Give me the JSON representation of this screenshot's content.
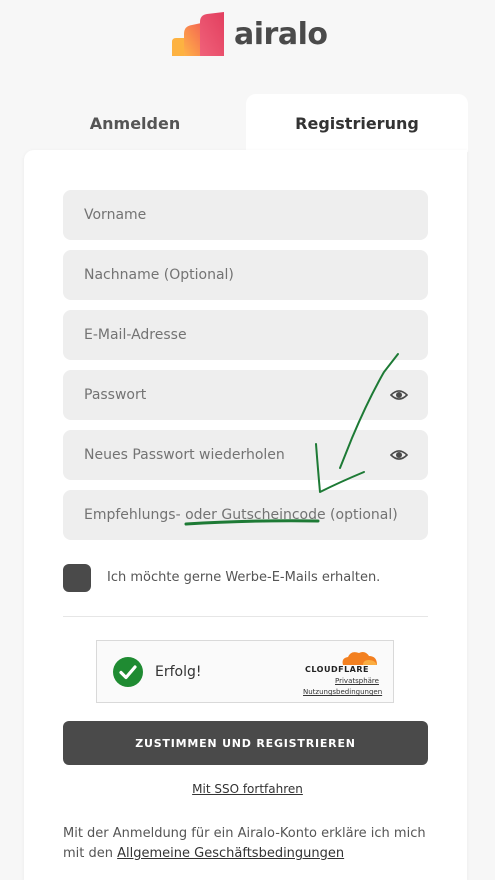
{
  "brand": {
    "name": "airalo"
  },
  "tabs": {
    "login": "Anmelden",
    "register": "Registrierung"
  },
  "form": {
    "first_name_placeholder": "Vorname",
    "last_name_placeholder": "Nachname (Optional)",
    "email_placeholder": "E-Mail-Adresse",
    "password_placeholder": "Passwort",
    "password_repeat_placeholder": "Neues Passwort wiederholen",
    "referral_placeholder": "Empfehlungs- oder Gutscheincode (optional)",
    "newsletter_label": "Ich möchte gerne Werbe-E-Mails erhalten."
  },
  "captcha": {
    "status": "Erfolg!",
    "brand": "CLOUDFLARE",
    "privacy": "Privatsphäre",
    "terms": "Nutzungsbedingungen"
  },
  "actions": {
    "submit": "ZUSTIMMEN UND REGISTRIEREN",
    "sso": "Mit SSO fortfahren"
  },
  "legal": {
    "text": "Mit der Anmeldung für ein Airalo-Konto erkläre ich mich mit den ",
    "link": "Allgemeine Geschäftsbedingungen"
  },
  "colors": {
    "primary_dark": "#4a4a4a",
    "success": "#1f8b32",
    "cloudflare_orange": "#f38020",
    "annotation": "#1d7a35"
  },
  "icons": [
    "eye-icon",
    "check-icon",
    "cloudflare-logo"
  ]
}
